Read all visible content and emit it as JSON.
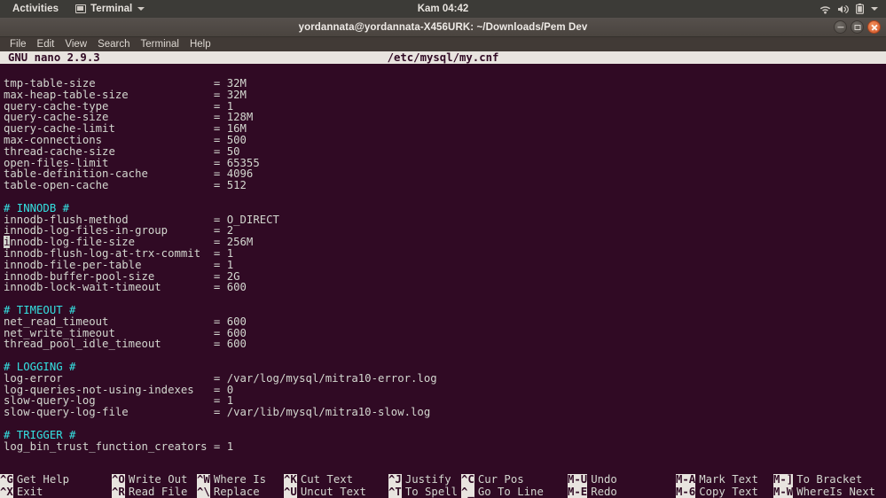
{
  "topbar": {
    "activities": "Activities",
    "app_menu": "Terminal",
    "clock": "Kam 04:42",
    "icons": [
      "wifi-icon",
      "volume-icon",
      "battery-icon",
      "chevron-down-icon"
    ]
  },
  "window": {
    "title": "yordannata@yordannata-X456URK: ~/Downloads/Pem Dev",
    "controls": [
      "minimize-button",
      "maximize-button",
      "close-button"
    ]
  },
  "menubar": {
    "items": [
      "File",
      "Edit",
      "View",
      "Search",
      "Terminal",
      "Help"
    ]
  },
  "nano": {
    "version": "GNU nano 2.9.3",
    "filename": "/etc/mysql/my.cnf",
    "lines": [
      {
        "text": "tmp-table-size                  = 32M",
        "type": "config"
      },
      {
        "text": "max-heap-table-size             = 32M",
        "type": "config"
      },
      {
        "text": "query-cache-type                = 1",
        "type": "config"
      },
      {
        "text": "query-cache-size                = 128M",
        "type": "config"
      },
      {
        "text": "query-cache-limit               = 16M",
        "type": "config"
      },
      {
        "text": "max-connections                 = 500",
        "type": "config"
      },
      {
        "text": "thread-cache-size               = 50",
        "type": "config"
      },
      {
        "text": "open-files-limit                = 65355",
        "type": "config"
      },
      {
        "text": "table-definition-cache          = 4096",
        "type": "config"
      },
      {
        "text": "table-open-cache                = 512",
        "type": "config"
      },
      {
        "text": "",
        "type": "blank"
      },
      {
        "text": "# INNODB #",
        "type": "comment"
      },
      {
        "text": "innodb-flush-method             = O_DIRECT",
        "type": "config"
      },
      {
        "text": "innodb-log-files-in-group       = 2",
        "type": "config"
      },
      {
        "text": "innodb-log-file-size            = 256M",
        "type": "cursor",
        "cursor_col": 0
      },
      {
        "text": "innodb-flush-log-at-trx-commit  = 1",
        "type": "config"
      },
      {
        "text": "innodb-file-per-table           = 1",
        "type": "config"
      },
      {
        "text": "innodb-buffer-pool-size         = 2G",
        "type": "config"
      },
      {
        "text": "innodb-lock-wait-timeout        = 600",
        "type": "config"
      },
      {
        "text": "",
        "type": "blank"
      },
      {
        "text": "# TIMEOUT #",
        "type": "comment"
      },
      {
        "text": "net_read_timeout                = 600",
        "type": "config"
      },
      {
        "text": "net_write_timeout               = 600",
        "type": "config"
      },
      {
        "text": "thread_pool_idle_timeout        = 600",
        "type": "config"
      },
      {
        "text": "",
        "type": "blank"
      },
      {
        "text": "# LOGGING #",
        "type": "comment"
      },
      {
        "text": "log-error                       = /var/log/mysql/mitra10-error.log",
        "type": "config"
      },
      {
        "text": "log-queries-not-using-indexes   = 0",
        "type": "config"
      },
      {
        "text": "slow-query-log                  = 1",
        "type": "config"
      },
      {
        "text": "slow-query-log-file             = /var/lib/mysql/mitra10-slow.log",
        "type": "config"
      },
      {
        "text": "",
        "type": "blank"
      },
      {
        "text": "# TRIGGER #",
        "type": "comment"
      },
      {
        "text": "log_bin_trust_function_creators = 1",
        "type": "config"
      }
    ],
    "shortcuts_row1": [
      {
        "key": "^G",
        "label": "Get Help"
      },
      {
        "key": "^O",
        "label": "Write Out"
      },
      {
        "key": "^W",
        "label": "Where Is"
      },
      {
        "key": "^K",
        "label": "Cut Text"
      },
      {
        "key": "^J",
        "label": "Justify"
      },
      {
        "key": "^C",
        "label": "Cur Pos"
      },
      {
        "key": "M-U",
        "label": "Undo"
      },
      {
        "key": "M-A",
        "label": "Mark Text"
      },
      {
        "key": "M-]",
        "label": "To Bracket"
      }
    ],
    "shortcuts_row2": [
      {
        "key": "^X",
        "label": "Exit"
      },
      {
        "key": "^R",
        "label": "Read File"
      },
      {
        "key": "^\\",
        "label": "Replace"
      },
      {
        "key": "^U",
        "label": "Uncut Text"
      },
      {
        "key": "^T",
        "label": "To Spell"
      },
      {
        "key": "^_",
        "label": "Go To Line"
      },
      {
        "key": "M-E",
        "label": "Redo"
      },
      {
        "key": "M-6",
        "label": "Copy Text"
      },
      {
        "key": "M-W",
        "label": "WhereIs Next"
      }
    ]
  },
  "colors": {
    "terminal_bg": "#300a24",
    "terminal_fg": "#d3d7cf",
    "comment": "#34e2e2",
    "titlebar_bg": "#4a443f",
    "topbar_bg": "#3c3b37",
    "close_button": "#d4582a"
  }
}
